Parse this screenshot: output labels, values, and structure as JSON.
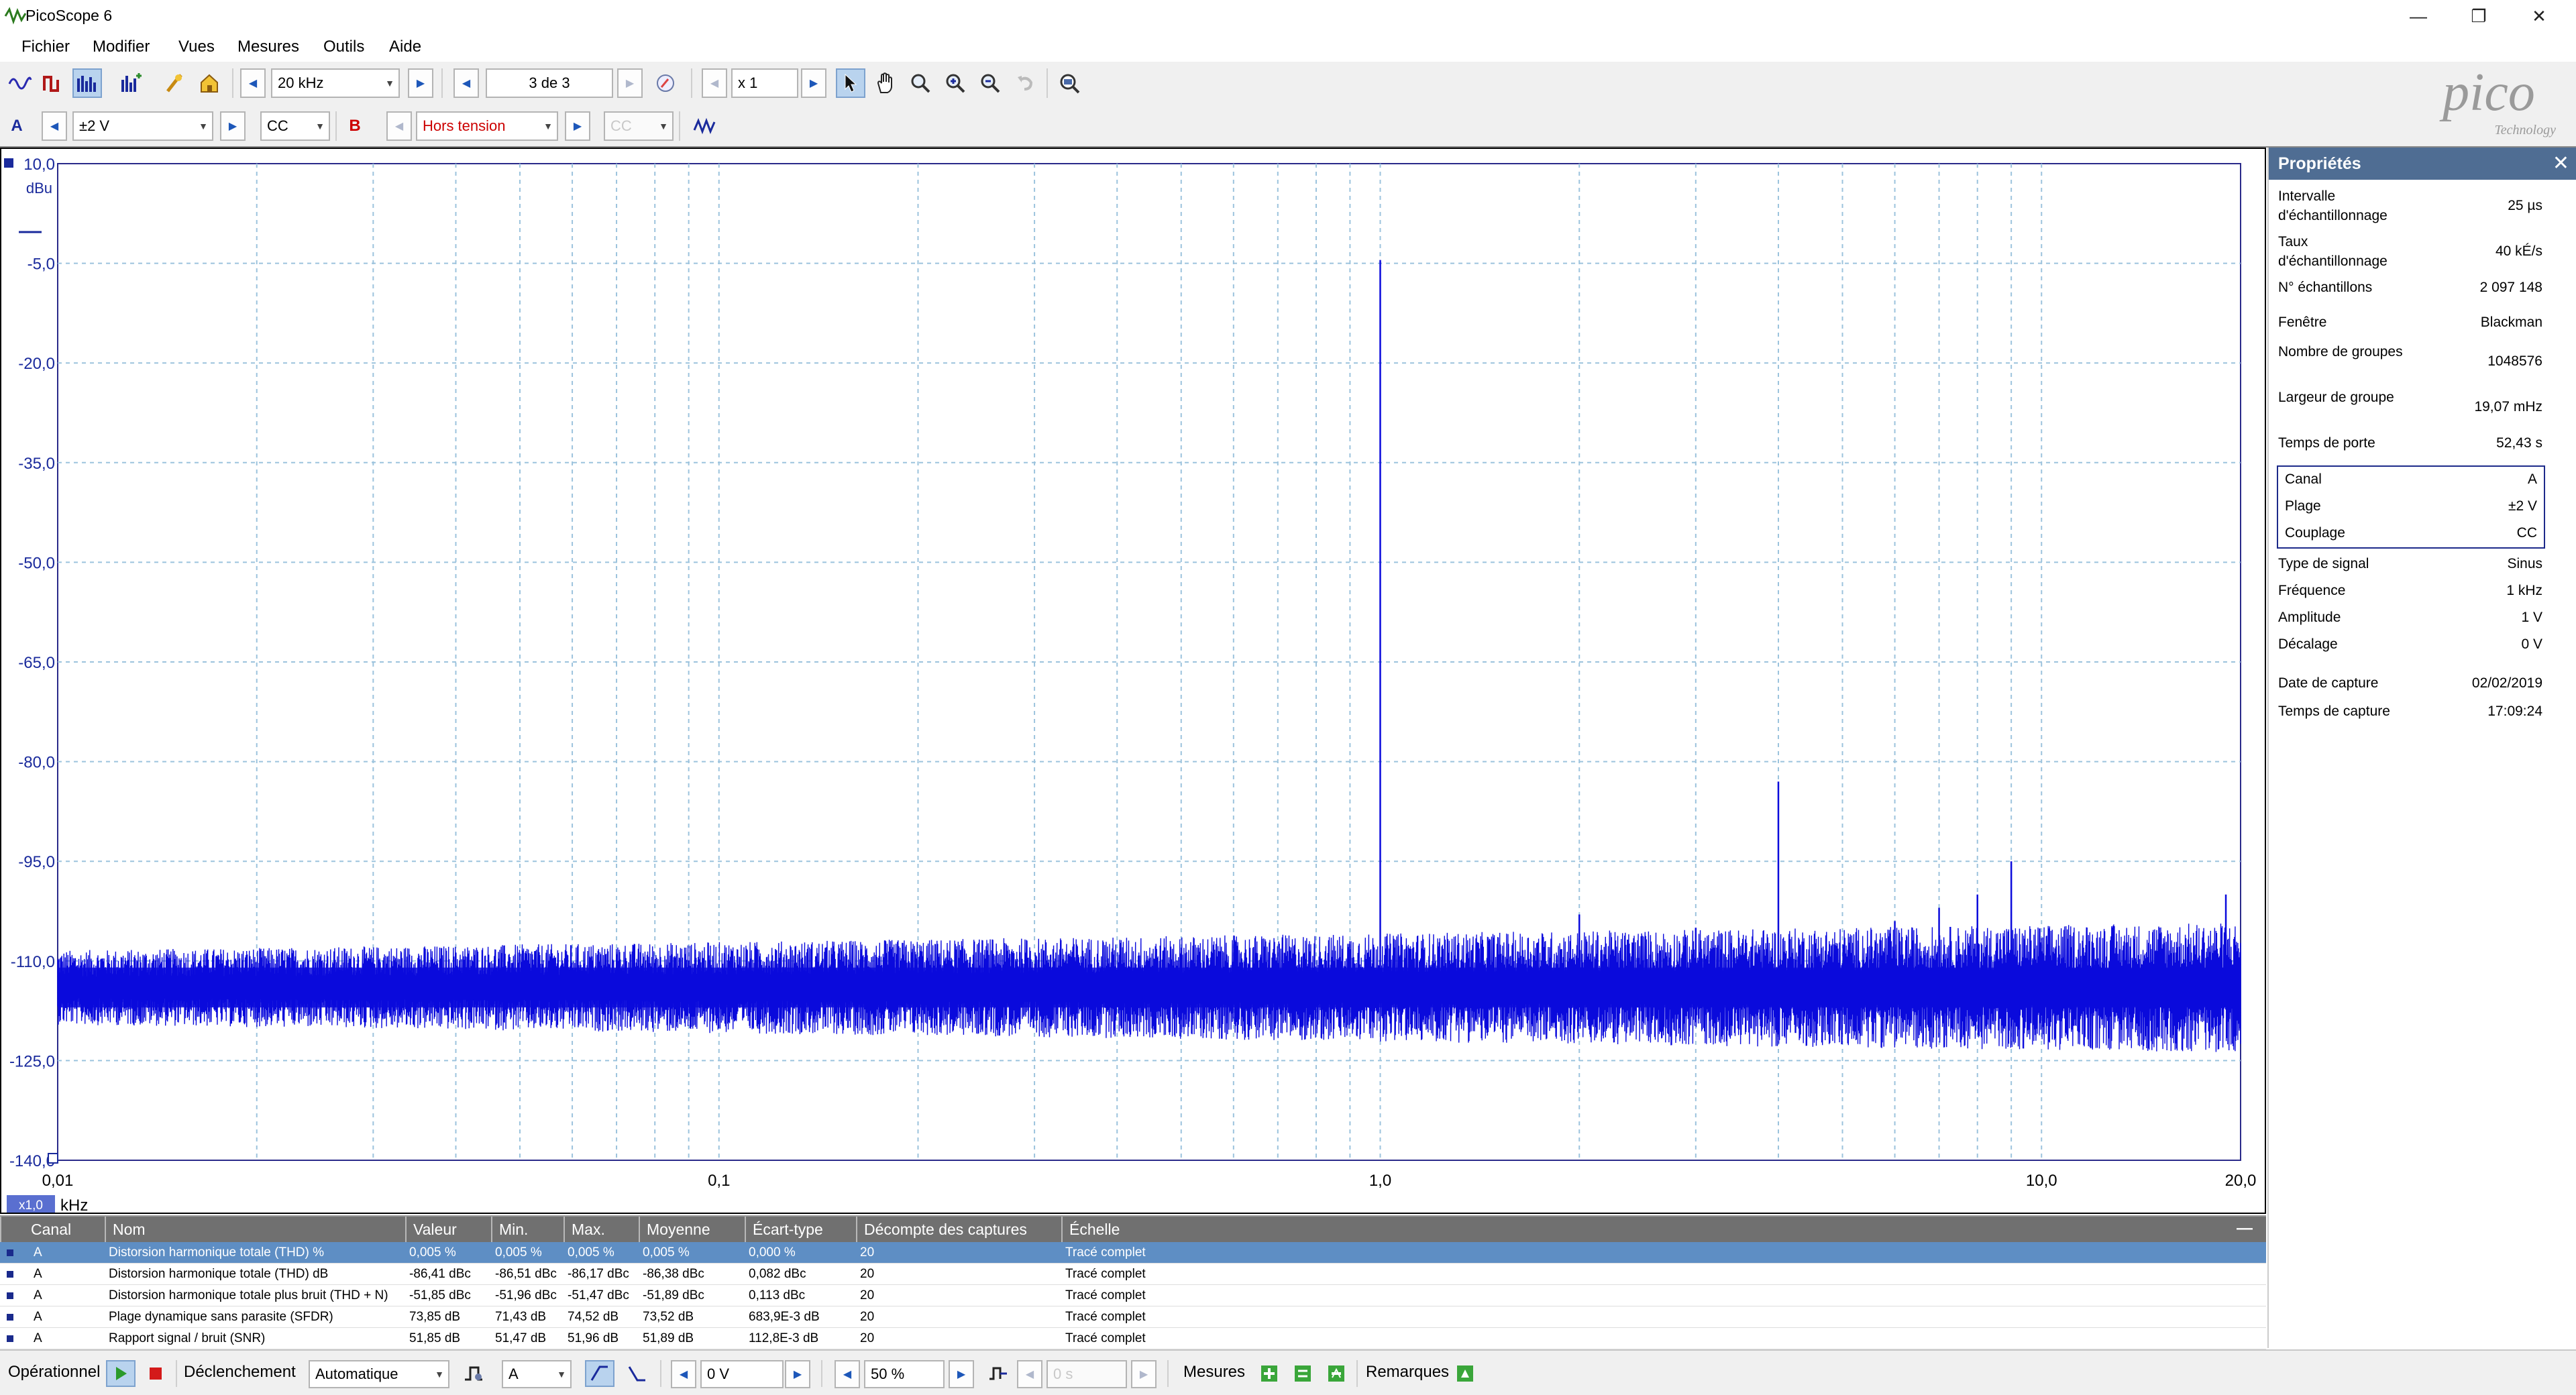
{
  "window": {
    "title": "PicoScope 6",
    "minimize": "—",
    "maximize": "❐",
    "close": "✕"
  },
  "menu": [
    "Fichier",
    "Modifier",
    "Vues",
    "Mesures",
    "Outils",
    "Aide"
  ],
  "toolbar": {
    "frequency": "20 kHz",
    "buffer": "3 de 3",
    "zoom": "x 1"
  },
  "channels": {
    "a": {
      "label": "A",
      "range": "±2 V",
      "coupling": "CC"
    },
    "b": {
      "label": "B",
      "range": "Hors tension",
      "coupling": "CC"
    }
  },
  "logo": {
    "name": "pico",
    "sub": "Technology"
  },
  "chart_data": {
    "type": "line",
    "title": "",
    "ylabel": "dBu",
    "xlabel": "kHz",
    "x_scale": "log",
    "xlim": [
      0.01,
      20.0
    ],
    "ylim": [
      -140,
      10
    ],
    "x_ticks": [
      "0,01",
      "0,1",
      "1,0",
      "10,0",
      "20,0"
    ],
    "y_ticks": [
      "10,0",
      "-5,0",
      "-20,0",
      "-35,0",
      "-50,0",
      "-65,0",
      "-80,0",
      "-95,0",
      "-110,0",
      "-125,0",
      "-140,0"
    ],
    "x_zoom_badge": "x1,0",
    "grid": true,
    "series": [
      {
        "color": "#0a0adc",
        "noise_floor_dbu": -114,
        "peaks": [
          {
            "x": 1.0,
            "y": -4.5
          },
          {
            "x": 2.0,
            "y": -103
          },
          {
            "x": 3.0,
            "y": -105
          },
          {
            "x": 4.0,
            "y": -83
          },
          {
            "x": 6.0,
            "y": -104
          },
          {
            "x": 7.0,
            "y": -102
          },
          {
            "x": 8.0,
            "y": -100
          },
          {
            "x": 9.0,
            "y": -95
          },
          {
            "x": 12.0,
            "y": -108
          },
          {
            "x": 19.0,
            "y": -100
          }
        ]
      }
    ]
  },
  "measurements": {
    "headers": [
      "Canal",
      "Nom",
      "Valeur",
      "Min.",
      "Max.",
      "Moyenne",
      "Écart-type",
      "Décompte des captures",
      "Échelle"
    ],
    "rows": [
      [
        "A",
        "Distorsion harmonique totale (THD) %",
        "0,005 %",
        "0,005 %",
        "0,005 %",
        "0,005 %",
        "0,000 %",
        "20",
        "Tracé complet"
      ],
      [
        "A",
        "Distorsion harmonique totale (THD) dB",
        "-86,41 dBc",
        "-86,51 dBc",
        "-86,17 dBc",
        "-86,38 dBc",
        "0,082 dBc",
        "20",
        "Tracé complet"
      ],
      [
        "A",
        "Distorsion harmonique totale plus bruit (THD + N)",
        "-51,85 dBc",
        "-51,96 dBc",
        "-51,47 dBc",
        "-51,89 dBc",
        "0,113 dBc",
        "20",
        "Tracé complet"
      ],
      [
        "A",
        "Plage dynamique sans parasite (SFDR)",
        "73,85 dB",
        "71,43 dB",
        "74,52 dB",
        "73,52 dB",
        "683,9E-3 dB",
        "20",
        "Tracé complet"
      ],
      [
        "A",
        "Rapport signal / bruit (SNR)",
        "51,85 dB",
        "51,47 dB",
        "51,96 dB",
        "51,89 dB",
        "112,8E-3 dB",
        "20",
        "Tracé complet"
      ]
    ]
  },
  "properties": {
    "title": "Propriétés",
    "items": [
      {
        "label": "Intervalle d'échantillonnage",
        "value": "25 µs"
      },
      {
        "label": "Taux d'échantillonnage",
        "value": "40 kÉ/s"
      },
      {
        "label": "N° échantillons",
        "value": "2 097 148"
      },
      {
        "label": "Fenêtre",
        "value": "Blackman"
      },
      {
        "label": "Nombre de groupes",
        "value": "1048576"
      },
      {
        "label": "Largeur de groupe",
        "value": "19,07 mHz"
      },
      {
        "label": "Temps de porte",
        "value": "52,43 s"
      }
    ],
    "channel_box": [
      {
        "label": "Canal",
        "value": "A"
      },
      {
        "label": "Plage",
        "value": "±2 V"
      },
      {
        "label": "Couplage",
        "value": "CC"
      }
    ],
    "signal": [
      {
        "label": "Type de signal",
        "value": "Sinus"
      },
      {
        "label": "Fréquence",
        "value": "1 kHz"
      },
      {
        "label": "Amplitude",
        "value": "1 V"
      },
      {
        "label": "Décalage",
        "value": "0 V"
      }
    ],
    "capture": [
      {
        "label": "Date de capture",
        "value": "02/02/2019"
      },
      {
        "label": "Temps de capture",
        "value": "17:09:24"
      }
    ]
  },
  "status": {
    "run": "Opérationnel",
    "trigger_label": "Déclenchement",
    "trigger_mode": "Automatique",
    "trigger_channel": "A",
    "trigger_level": "0 V",
    "pre_trigger": "50 %",
    "delay": "0 s",
    "measures": "Mesures",
    "notes": "Remarques"
  }
}
